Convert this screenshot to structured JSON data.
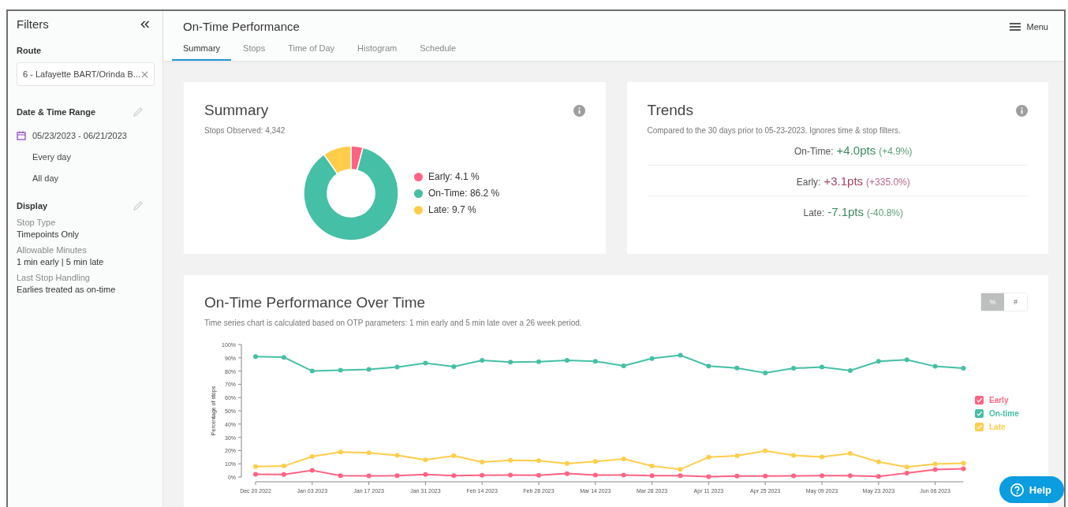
{
  "sidebar": {
    "title": "Filters",
    "route": {
      "label": "Route",
      "value": "6 - Lafayette BART/Orinda B..."
    },
    "date_range": {
      "title": "Date & Time Range",
      "range": "05/23/2023 - 06/21/2023",
      "days": "Every day",
      "hours": "All day"
    },
    "display": {
      "title": "Display",
      "items": [
        {
          "label": "Stop Type",
          "value": "Timepoints Only"
        },
        {
          "label": "Allowable Minutes",
          "value": "1 min early | 5 min late"
        },
        {
          "label": "Last Stop Handling",
          "value": "Earlies treated as on-time"
        }
      ]
    }
  },
  "header": {
    "title": "On-Time Performance",
    "menu": "Menu",
    "tabs": [
      {
        "label": "Summary",
        "selected": true
      },
      {
        "label": "Stops",
        "selected": false
      },
      {
        "label": "Time of Day",
        "selected": false
      },
      {
        "label": "Histogram",
        "selected": false
      },
      {
        "label": "Schedule",
        "selected": false
      }
    ]
  },
  "summary": {
    "title": "Summary",
    "subtitle": "Stops Observed: 4,342",
    "chart_data": {
      "type": "donut",
      "values": [
        4.1,
        86.2,
        9.7
      ]
    },
    "legend": [
      {
        "label": "Early: 4.1 %",
        "color": "#ff6384"
      },
      {
        "label": "On-Time: 86.2 %",
        "color": "#45bfa5"
      },
      {
        "label": "Late: 9.7 %",
        "color": "#ffcd4a"
      }
    ]
  },
  "trends": {
    "title": "Trends",
    "note": "Compared to the 30 days prior to 05-23-2023. Ignores time & stop filters.",
    "rows": [
      {
        "label": "On-Time:",
        "value": "+4.0pts",
        "change": "(+4.9%)",
        "favorable": true
      },
      {
        "label": "Early:",
        "value": "+3.1pts",
        "change": "(+335.0%)",
        "favorable": false
      },
      {
        "label": "Late:",
        "value": "-7.1pts",
        "change": "(-40.8%)",
        "favorable": true
      }
    ]
  },
  "over_time": {
    "title": "On-Time Performance Over Time",
    "note": "Time series chart is calculated based on OTP parameters: 1 min early and 5 min late over a 26 week period.",
    "toggle": [
      {
        "label": "%",
        "selected": true
      },
      {
        "label": "#",
        "selected": false
      }
    ],
    "legend": [
      {
        "checked": true
      },
      {
        "checked": true
      },
      {
        "checked": true
      }
    ],
    "chart_data": {
      "type": "line",
      "ylabel": "Percentage of stops",
      "categories": [
        "Dec 20 2022",
        null,
        "Jan 03 2023",
        null,
        "Jan 17 2023",
        null,
        "Jan 31 2023",
        null,
        "Feb 14 2023",
        null,
        "Feb 28 2023",
        null,
        "Mar 14 2023",
        null,
        "Mar 28 2023",
        null,
        "Apr 11 2023",
        null,
        "Apr 25 2023",
        null,
        "May 09 2023",
        null,
        "May 23 2023",
        null,
        "Jun 06 2023",
        null
      ],
      "ylim": [
        0,
        100
      ],
      "yticks": [
        {
          "value": 0,
          "label": "0%"
        },
        {
          "value": 10,
          "label": "10%"
        },
        {
          "value": 20,
          "label": "20%"
        },
        {
          "value": 30,
          "label": "30%"
        },
        {
          "value": 40,
          "label": "40%"
        },
        {
          "value": 50,
          "label": "50%"
        },
        {
          "value": 60,
          "label": "60%"
        },
        {
          "value": 70,
          "label": "70%"
        },
        {
          "value": 80,
          "label": "80%"
        },
        {
          "value": 90,
          "label": "90%"
        },
        {
          "value": 100,
          "label": "100%"
        }
      ],
      "series": [
        {
          "name": "Early",
          "color": "#ff6384",
          "marker": "circle",
          "values": [
            2.1,
            1.9,
            5.1,
            1.1,
            0.9,
            1.1,
            1.9,
            1.1,
            1.3,
            1.5,
            1.3,
            2.6,
            1.5,
            1.5,
            1.0,
            1.0,
            0.3,
            0.8,
            0.8,
            0.9,
            1.0,
            1.0,
            0.4,
            3.0,
            5.6,
            6.3
          ]
        },
        {
          "name": "On-time",
          "color": "#45bfa5",
          "marker": "circle",
          "values": [
            90.9,
            90.4,
            80.0,
            80.6,
            81.3,
            83.0,
            86.0,
            83.4,
            88.1,
            86.8,
            87.0,
            88.1,
            87.4,
            84.0,
            89.5,
            91.9,
            83.8,
            82.3,
            78.6,
            82.1,
            83.0,
            80.4,
            87.3,
            88.6,
            83.6,
            82.1
          ]
        },
        {
          "name": "Late",
          "color": "#ffcd4a",
          "marker": "circle",
          "values": [
            7.9,
            8.3,
            15.5,
            18.9,
            18.3,
            16.4,
            13.0,
            16.0,
            11.3,
            12.6,
            12.3,
            10.2,
            11.7,
            13.7,
            8.4,
            5.8,
            15.0,
            16.1,
            19.8,
            16.3,
            15.2,
            17.8,
            11.5,
            7.6,
            9.8,
            10.4
          ]
        }
      ]
    }
  },
  "help": {
    "label": "Help"
  }
}
